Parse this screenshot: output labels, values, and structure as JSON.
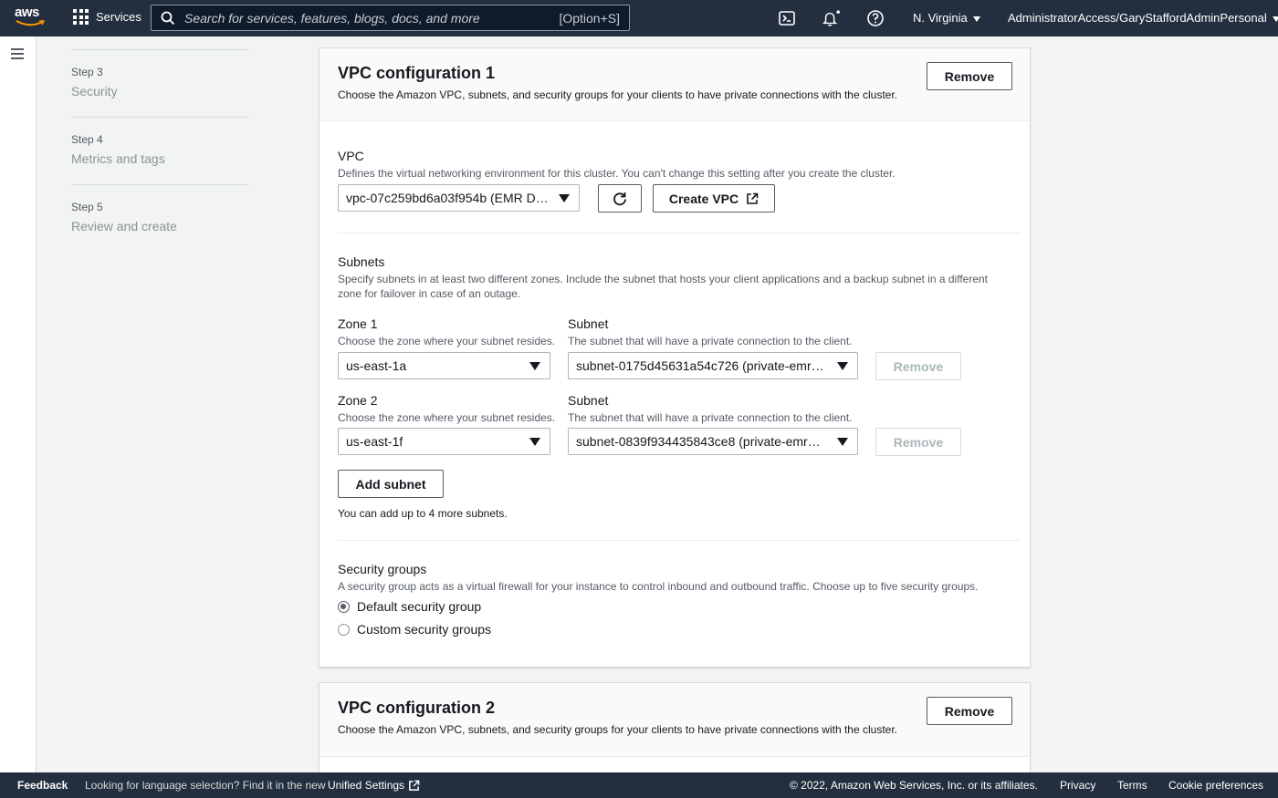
{
  "nav": {
    "logo_text": "aws",
    "services_label": "Services",
    "search_placeholder": "Search for services, features, blogs, docs, and more",
    "search_shortcut": "[Option+S]",
    "region": "N. Virginia",
    "account": "AdministratorAccess/GaryStaffordAdminPersonal",
    "icons": [
      "cloudshell-icon",
      "bell-icon",
      "help-icon"
    ]
  },
  "steps": [
    {
      "num": "Step 3",
      "label": "Security"
    },
    {
      "num": "Step 4",
      "label": "Metrics and tags"
    },
    {
      "num": "Step 5",
      "label": "Review and create"
    }
  ],
  "vpc1": {
    "title": "VPC configuration 1",
    "description": "Choose the Amazon VPC, subnets, and security groups for your clients to have private connections with the cluster.",
    "remove_label": "Remove",
    "vpc": {
      "label": "VPC",
      "description": "Defines the virtual networking environment for this cluster. You can't change this setting after you create the cluster.",
      "selected": "vpc-07c259bd6a03f954b (EMR D…",
      "create_label": "Create VPC"
    },
    "subnets": {
      "label": "Subnets",
      "description": "Specify subnets in at least two different zones. Include the subnet that hosts your client applications and a backup subnet in a different zone for failover in case of an outage.",
      "rows": [
        {
          "zone_label": "Zone 1",
          "zone_desc": "Choose the zone where your subnet resides.",
          "zone_value": "us-east-1a",
          "subnet_label": "Subnet",
          "subnet_desc": "The subnet that will have a private connection to the client.",
          "subnet_value": "subnet-0175d45631a54c726 (private-emr…",
          "remove_label": "Remove"
        },
        {
          "zone_label": "Zone 2",
          "zone_desc": "Choose the zone where your subnet resides.",
          "zone_value": "us-east-1f",
          "subnet_label": "Subnet",
          "subnet_desc": "The subnet that will have a private connection to the client.",
          "subnet_value": "subnet-0839f934435843ce8 (private-emr…",
          "remove_label": "Remove"
        }
      ],
      "add_label": "Add subnet",
      "add_hint": "You can add up to 4 more subnets."
    },
    "security": {
      "label": "Security groups",
      "description": "A security group acts as a virtual firewall for your instance to control inbound and outbound traffic. Choose up to five security groups.",
      "options": [
        {
          "label": "Default security group",
          "selected": true
        },
        {
          "label": "Custom security groups",
          "selected": false
        }
      ]
    }
  },
  "vpc2": {
    "title": "VPC configuration 2",
    "description": "Choose the Amazon VPC, subnets, and security groups for your clients to have private connections with the cluster.",
    "remove_label": "Remove"
  },
  "footer": {
    "feedback": "Feedback",
    "language_prompt": "Looking for language selection? Find it in the new",
    "unified_settings": "Unified Settings",
    "copyright": "© 2022, Amazon Web Services, Inc. or its affiliates.",
    "privacy": "Privacy",
    "terms": "Terms",
    "cookies": "Cookie preferences"
  },
  "colors": {
    "nav_bg": "#232f3e",
    "page_bg": "#f2f3f3",
    "text": "#16191f",
    "secondary_text": "#545b64",
    "disabled_text": "#aab7b8"
  }
}
